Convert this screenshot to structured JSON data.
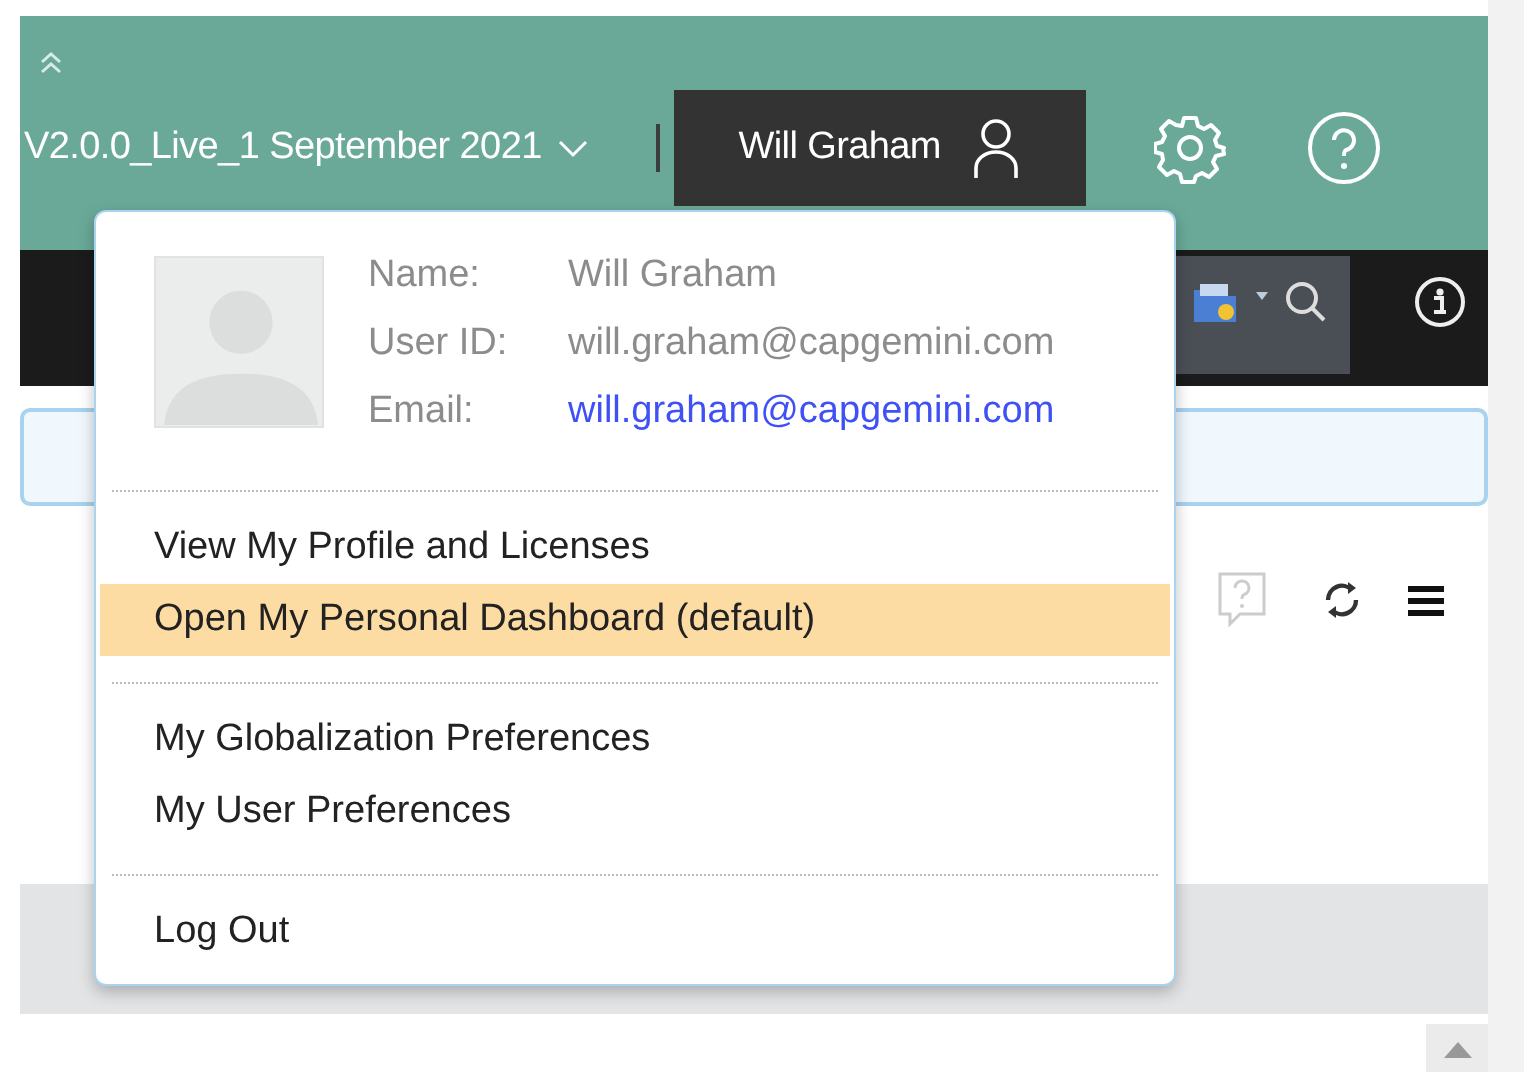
{
  "header": {
    "version": "V2.0.0_Live_1 September 2021",
    "user": "Will Graham"
  },
  "user_menu": {
    "profile": [
      {
        "label": "Name:",
        "value": "Will Graham",
        "kind": "text"
      },
      {
        "label": "User ID:",
        "value": "will.graham@capgemini.com",
        "kind": "text"
      },
      {
        "label": "Email:",
        "value": "will.graham@capgemini.com",
        "kind": "link"
      }
    ],
    "groups": [
      [
        {
          "label": "View My Profile and Licenses",
          "selected": false
        },
        {
          "label": "Open My Personal Dashboard (default)",
          "selected": true
        }
      ],
      [
        {
          "label": "My Globalization Preferences",
          "selected": false
        },
        {
          "label": "My User Preferences",
          "selected": false
        }
      ],
      [
        {
          "label": "Log Out",
          "selected": false
        }
      ]
    ]
  }
}
